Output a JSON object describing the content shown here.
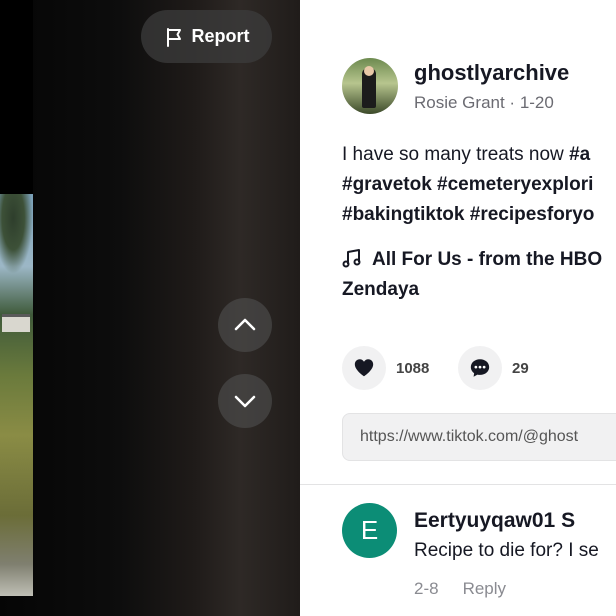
{
  "video": {
    "report_label": "Report"
  },
  "author": {
    "username": "ghostlyarchive",
    "display_name": "Rosie Grant",
    "date": "1-20",
    "separator": " · "
  },
  "description": {
    "line1_text": "I have so many treats now ",
    "line1_tag": "#a",
    "line2": "#gravetok #cemeteryexplori",
    "line3": "#bakingtiktok #recipesforyo"
  },
  "music": {
    "line1": "All For Us - from the HBO",
    "line2": "Zendaya"
  },
  "stats": {
    "likes": "1088",
    "comments": "29"
  },
  "share": {
    "link": "https://www.tiktok.com/@ghost"
  },
  "comments": [
    {
      "avatar_letter": "E",
      "username": "Eertyuyqaw01 S",
      "text": "Recipe to die for? I se",
      "date": "2-8",
      "reply_label": "Reply"
    }
  ],
  "colors": {
    "comment_avatar": "#0c8d76",
    "text_primary": "#161823",
    "text_secondary": "#6b6b72"
  }
}
